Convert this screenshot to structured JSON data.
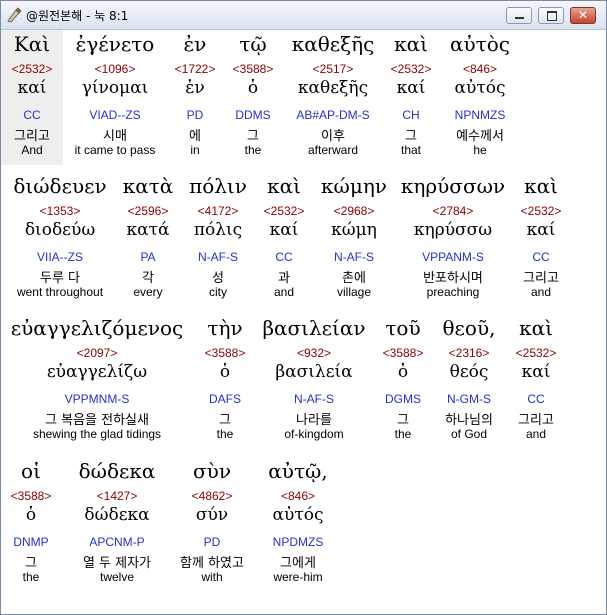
{
  "window": {
    "title": "@원전본해 - 눅 8:1"
  },
  "rows": [
    {
      "words": [
        {
          "greek": "Καὶ",
          "strong": "<2532>",
          "lemma": "καί",
          "parse": "CC",
          "korean": "그리고",
          "english": "And"
        },
        {
          "greek": "ἐγένετο",
          "strong": "<1096>",
          "lemma": "γίνομαι",
          "parse": "VIAD--ZS",
          "korean": "시매",
          "english": "it came to pass"
        },
        {
          "greek": "ἐν",
          "strong": "<1722>",
          "lemma": "ἐν",
          "parse": "PD",
          "korean": "에",
          "english": "in"
        },
        {
          "greek": "τῷ",
          "strong": "<3588>",
          "lemma": "ὁ",
          "parse": "DDMS",
          "korean": "그",
          "english": "the"
        },
        {
          "greek": "καθεξῆς",
          "strong": "<2517>",
          "lemma": "καθεξῆς",
          "parse": "AB#AP-DM-S",
          "korean": "이후",
          "english": "afterward"
        },
        {
          "greek": "καὶ",
          "strong": "<2532>",
          "lemma": "καί",
          "parse": "CH",
          "korean": "그",
          "english": "that"
        },
        {
          "greek": "αὐτὸς",
          "strong": "<846>",
          "lemma": "αὐτός",
          "parse": "NPNMZS",
          "korean": "예수께서",
          "english": "he"
        }
      ]
    },
    {
      "words": [
        {
          "greek": "διώδευεν",
          "strong": "<1353>",
          "lemma": "διοδεύω",
          "parse": "VIIA--ZS",
          "korean": "두루 다",
          "english": "went throughout"
        },
        {
          "greek": "κατὰ",
          "strong": "<2596>",
          "lemma": "κατά",
          "parse": "PA",
          "korean": "각",
          "english": "every"
        },
        {
          "greek": "πόλιν",
          "strong": "<4172>",
          "lemma": "πόλις",
          "parse": "N-AF-S",
          "korean": "성",
          "english": "city"
        },
        {
          "greek": "καὶ",
          "strong": "<2532>",
          "lemma": "καί",
          "parse": "CC",
          "korean": "과",
          "english": "and"
        },
        {
          "greek": "κώμην",
          "strong": "<2968>",
          "lemma": "κώμη",
          "parse": "N-AF-S",
          "korean": "촌에",
          "english": "village"
        },
        {
          "greek": "κηρύσσων",
          "strong": "<2784>",
          "lemma": "κηρύσσω",
          "parse": "VPPANM-S",
          "korean": "반포하시며",
          "english": "preaching"
        },
        {
          "greek": "καὶ",
          "strong": "<2532>",
          "lemma": "καί",
          "parse": "CC",
          "korean": "그리고",
          "english": "and"
        }
      ]
    },
    {
      "words": [
        {
          "greek": "εὐαγγελιζόμενος",
          "strong": "<2097>",
          "lemma": "εὐαγγελίζω",
          "parse": "VPPMNM-S",
          "korean": "그 복음을 전하실새",
          "english": "shewing the glad tidings"
        },
        {
          "greek": "τὴν",
          "strong": "<3588>",
          "lemma": "ὁ",
          "parse": "DAFS",
          "korean": "그",
          "english": "the"
        },
        {
          "greek": "βασιλείαν",
          "strong": "<932>",
          "lemma": "βασιλεία",
          "parse": "N-AF-S",
          "korean": "나라를",
          "english": "of-kingdom"
        },
        {
          "greek": "τοῦ",
          "strong": "<3588>",
          "lemma": "ὁ",
          "parse": "DGMS",
          "korean": "그",
          "english": "the"
        },
        {
          "greek": "θεοῦ,",
          "strong": "<2316>",
          "lemma": "θεός",
          "parse": "N-GM-S",
          "korean": "하나님의",
          "english": "of God"
        },
        {
          "greek": "καὶ",
          "strong": "<2532>",
          "lemma": "καί",
          "parse": "CC",
          "korean": "그리고",
          "english": "and"
        }
      ]
    },
    {
      "words": [
        {
          "greek": "οἱ",
          "strong": "<3588>",
          "lemma": "ὁ",
          "parse": "DNMP",
          "korean": "그",
          "english": "the"
        },
        {
          "greek": "δώδεκα",
          "strong": "<1427>",
          "lemma": "δώδεκα",
          "parse": "APCNM-P",
          "korean": "열 두 제자가",
          "english": "twelve"
        },
        {
          "greek": "σὺν",
          "strong": "<4862>",
          "lemma": "σύν",
          "parse": "PD",
          "korean": "함께 하였고",
          "english": "with"
        },
        {
          "greek": "αὐτῷ,",
          "strong": "<846>",
          "lemma": "αὐτός",
          "parse": "NPDMZS",
          "korean": "그에게",
          "english": "were-him"
        }
      ]
    }
  ]
}
